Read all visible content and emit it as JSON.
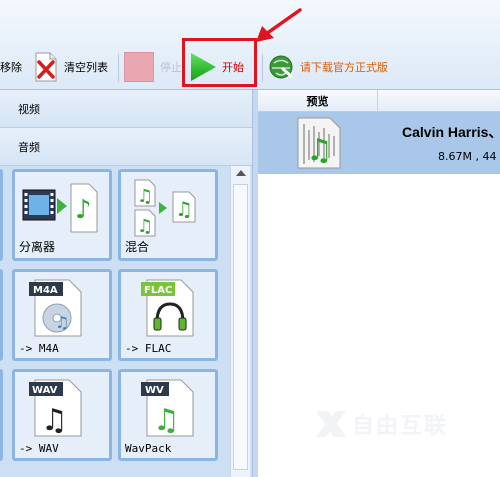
{
  "toolbar": {
    "remove_label": "移除",
    "clear_label": "清空列表",
    "stop_label": "停止",
    "start_label": "开始",
    "download_label": "请下载官方正式版"
  },
  "categories": {
    "video": "视频",
    "audio": "音频"
  },
  "tiles": [
    {
      "label": "分离器",
      "icon": "film-music-splitter-icon"
    },
    {
      "label": "混合",
      "icon": "music-merge-icon"
    },
    {
      "label": "-> M4A",
      "icon": "m4a-file-icon",
      "badge": "M4A"
    },
    {
      "label": "-> FLAC",
      "icon": "flac-file-icon",
      "badge": "FLAC"
    },
    {
      "label": "-> WAV",
      "icon": "wav-file-icon",
      "badge": "WAV"
    },
    {
      "label": "WavPack",
      "icon": "wv-file-icon",
      "badge": "WV"
    }
  ],
  "file_list": {
    "column_preview": "预览",
    "rows": [
      {
        "name": "Calvin Harris、",
        "meta": "8.67M , 44"
      }
    ]
  },
  "watermark": {
    "text": "自由互联"
  },
  "colors": {
    "highlight": "#e0141e",
    "start_green": "#1fb51f",
    "selected_row": "#a8c7e9",
    "tile_border": "#8cb5e2"
  }
}
